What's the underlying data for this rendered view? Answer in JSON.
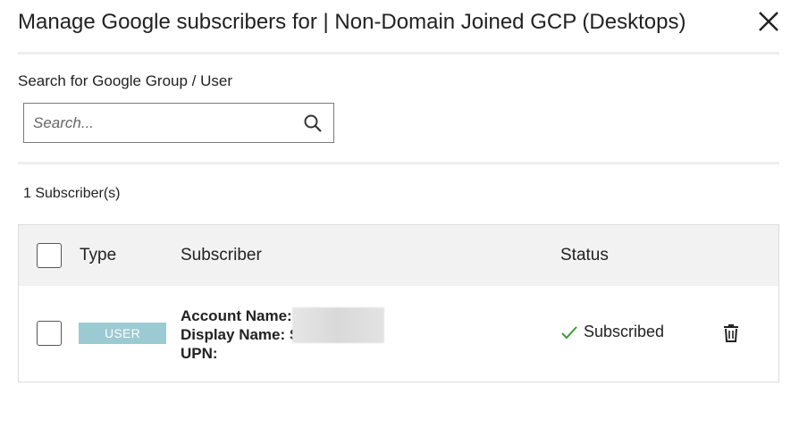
{
  "dialog": {
    "title": "Manage Google subscribers for | Non-Domain Joined GCP (Desktops)"
  },
  "search": {
    "label": "Search for Google Group / User",
    "placeholder": "Search...",
    "value": ""
  },
  "subscribers": {
    "count_text": "1 Subscriber(s)"
  },
  "table": {
    "headers": {
      "type": "Type",
      "subscriber": "Subscriber",
      "status": "Status"
    },
    "rows": [
      {
        "type_badge": "USER",
        "account_name_label": "Account Name:",
        "display_name_label": "Display Name: S",
        "upn_label": "UPN:",
        "status": "Subscribed"
      }
    ]
  },
  "colors": {
    "badge_bg": "#9ccad3",
    "status_check": "#3c9a3c",
    "header_bg": "#f2f2f2"
  },
  "icons": {
    "close": "close-icon",
    "search": "search-icon",
    "status": "checkmark-icon",
    "delete": "trash-icon"
  }
}
